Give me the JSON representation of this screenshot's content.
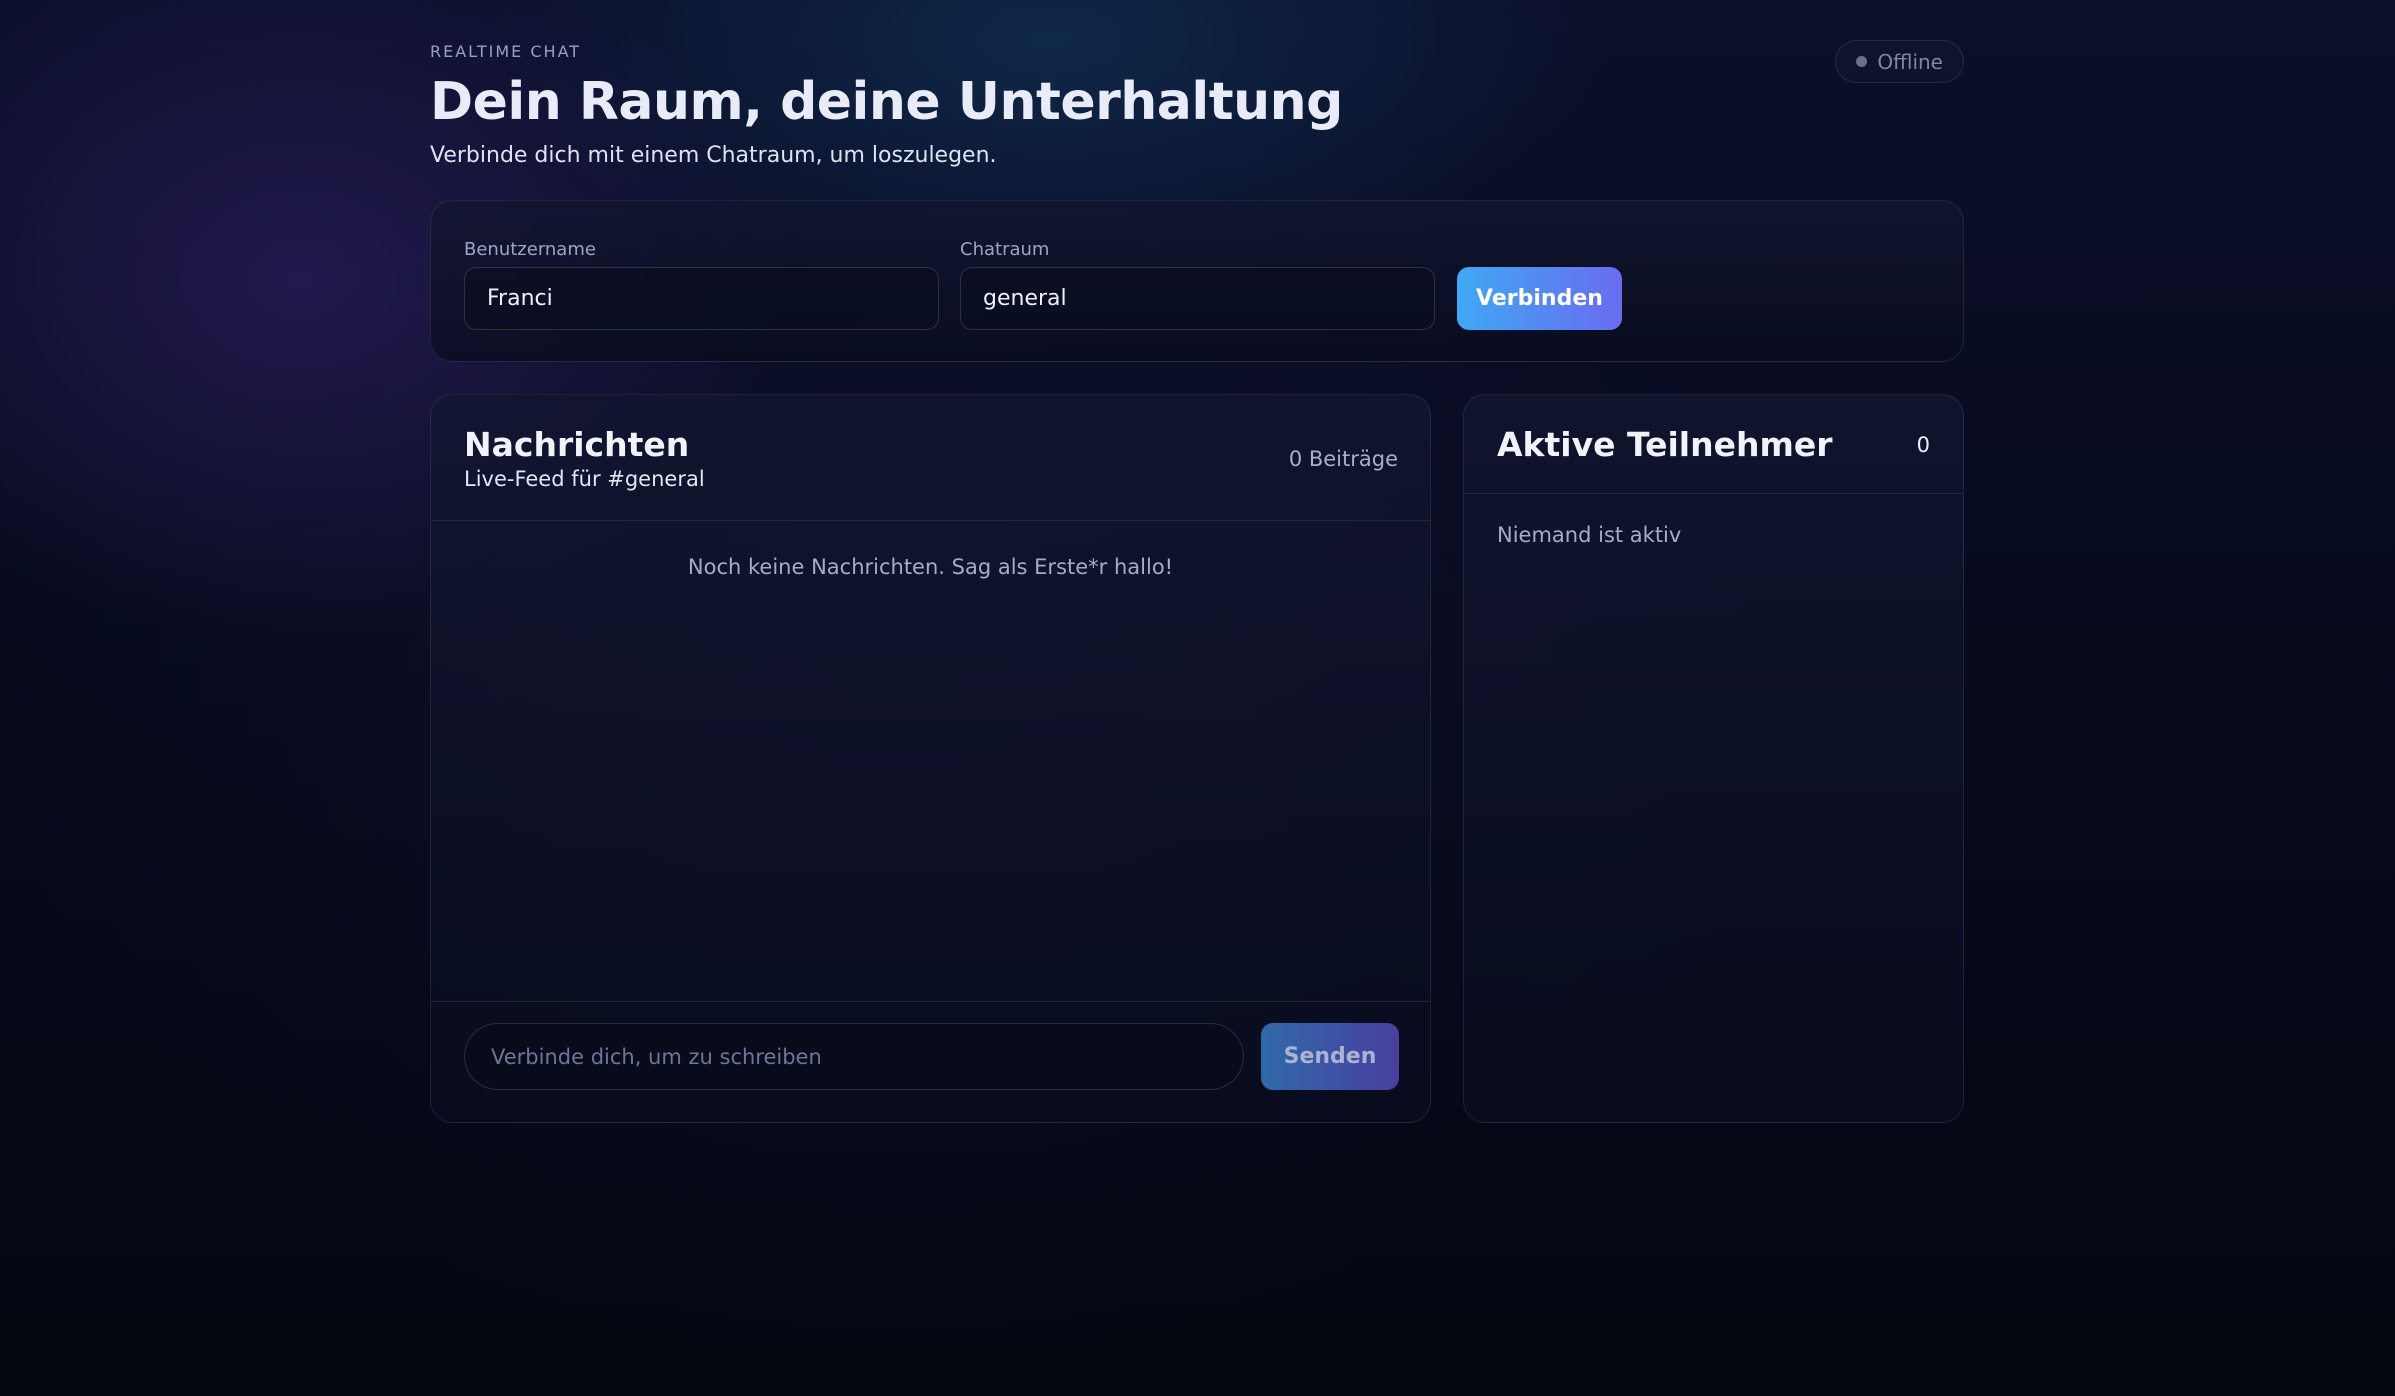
{
  "header": {
    "eyebrow": "REALTIME CHAT",
    "title": "Dein Raum, deine Unterhaltung",
    "subtitle": "Verbinde dich mit einem Chatraum, um loszulegen.",
    "status": "Offline"
  },
  "connect": {
    "username_label": "Benutzername",
    "username_value": "Franci",
    "room_label": "Chatraum",
    "room_value": "general",
    "button_label": "Verbinden"
  },
  "messages": {
    "title": "Nachrichten",
    "subtitle": "Live-Feed für #general",
    "count": "0 Beiträge",
    "empty": "Noch keine Nachrichten. Sag als Erste*r hallo!",
    "input_placeholder": "Verbinde dich, um zu schreiben",
    "send_label": "Senden"
  },
  "participants": {
    "title": "Aktive Teilnehmer",
    "count": "0",
    "empty": "Niemand ist aktiv"
  },
  "icons": {
    "status": "status-dot-icon"
  },
  "colors": {
    "accent_start": "#3fa8f4",
    "accent_end": "#6a6cf0",
    "status_offline": "#6b7290"
  }
}
